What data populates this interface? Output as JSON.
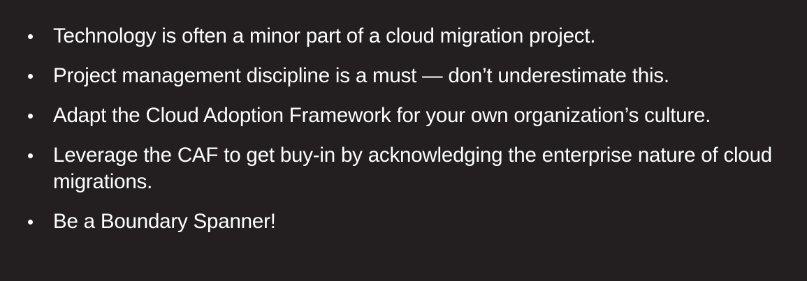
{
  "background_color": "#231f20",
  "text_color": "#ffffff",
  "bullets": [
    {
      "text": "Technology is often a minor part of a cloud migration project."
    },
    {
      "text": "Project management discipline is a must — don’t underestimate this."
    },
    {
      "text": "Adapt the Cloud Adoption Framework for your own organization’s culture."
    },
    {
      "text": "Leverage the CAF to get buy-in by acknowledging the enterprise nature of cloud migrations."
    },
    {
      "text": "Be a Boundary Spanner!"
    }
  ]
}
